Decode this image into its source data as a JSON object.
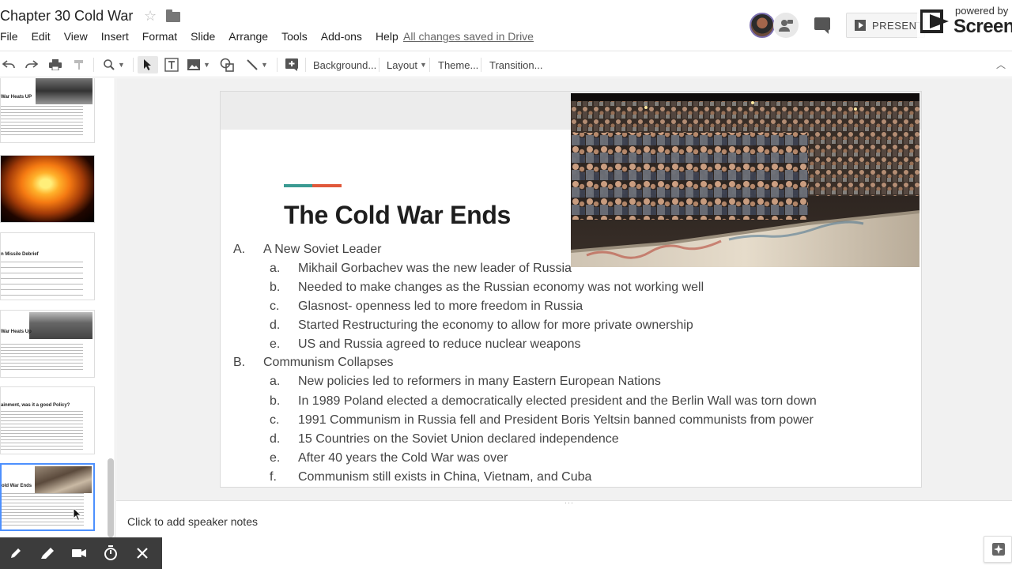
{
  "header": {
    "doc_title": "Chapter 30 Cold War",
    "menu": [
      "File",
      "Edit",
      "View",
      "Insert",
      "Format",
      "Slide",
      "Arrange",
      "Tools",
      "Add-ons",
      "Help"
    ],
    "save_status": "All changes saved in Drive",
    "present_label": "PRESENT",
    "watermark_top": "powered by",
    "watermark_main": "Screen"
  },
  "toolbar": {
    "background_label": "Background...",
    "layout_label": "Layout",
    "theme_label": "Theme...",
    "transition_label": "Transition..."
  },
  "filmstrip": {
    "thumbs": [
      {
        "title": "War Heats UP"
      },
      {
        "title": ""
      },
      {
        "title": "n Missile Debrief"
      },
      {
        "title": "War Heats Up"
      },
      {
        "title": "ainment, was it a good Policy?"
      },
      {
        "title": "old War Ends"
      }
    ],
    "selected_index": 5
  },
  "slide": {
    "title": "The Cold War Ends",
    "accent_colors": [
      "#3a9a92",
      "#e0583a"
    ],
    "sections": [
      {
        "marker": "A.",
        "text": "A New Soviet Leader",
        "items": [
          {
            "marker": "a.",
            "text": "Mikhail Gorbachev was the new leader of Russia"
          },
          {
            "marker": "b.",
            "text": "Needed to make changes as the Russian economy was not working well"
          },
          {
            "marker": "c.",
            "text": "Glasnost- openness led to more freedom in Russia"
          },
          {
            "marker": "d.",
            "text": "Started Restructuring the economy to allow for more private ownership"
          },
          {
            "marker": "e.",
            "text": "US and Russia agreed to reduce nuclear weapons"
          }
        ]
      },
      {
        "marker": "B.",
        "text": "Communism Collapses",
        "items": [
          {
            "marker": "a.",
            "text": "New policies led to reformers in many Eastern European Nations"
          },
          {
            "marker": "b.",
            "text": "In 1989 Poland elected a democratically elected president and the Berlin Wall was torn down"
          },
          {
            "marker": "c.",
            "text": "1991 Communism in Russia fell and President Boris Yeltsin banned communists from power"
          },
          {
            "marker": "d.",
            "text": "15 Countries on the Soviet Union declared independence"
          },
          {
            "marker": "e.",
            "text": "After 40 years the Cold War was over"
          },
          {
            "marker": "f.",
            "text": "Communism still exists in China, Vietnam, and Cuba"
          }
        ]
      }
    ]
  },
  "notes": {
    "placeholder": "Click to add speaker notes"
  },
  "recorder": {
    "tools": [
      "pen-icon",
      "highlighter-icon",
      "camera-icon",
      "timer-icon",
      "close-icon"
    ]
  }
}
